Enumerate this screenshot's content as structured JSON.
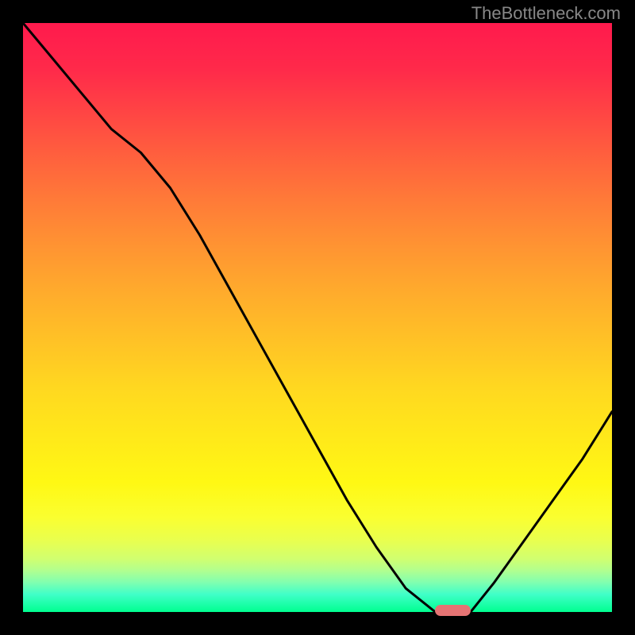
{
  "watermark": "TheBottleneck.com",
  "chart_data": {
    "type": "line",
    "title": "",
    "xlabel": "",
    "ylabel": "",
    "x": [
      0,
      5,
      10,
      15,
      20,
      25,
      30,
      35,
      40,
      45,
      50,
      55,
      60,
      65,
      70,
      73,
      76,
      80,
      85,
      90,
      95,
      100
    ],
    "values": [
      100,
      94,
      88,
      82,
      78,
      72,
      64,
      55,
      46,
      37,
      28,
      19,
      11,
      4,
      0,
      0,
      0,
      5,
      12,
      19,
      26,
      34
    ],
    "ylim": [
      0,
      100
    ],
    "xlim": [
      0,
      100
    ],
    "marker": {
      "x_start": 70,
      "x_end": 76,
      "y": 0
    },
    "background": "rainbow-gradient-red-to-green",
    "note": "V-shaped bottleneck curve. Values are approximate percentages read from image; minimum (optimal point) occurs around x=70-76%. Axes have no visible tick labels."
  },
  "colors": {
    "background": "#000000",
    "watermark": "#888888",
    "curve": "#000000",
    "marker": "#e57373",
    "gradient_top": "#ff1a4d",
    "gradient_bottom": "#00ff90"
  }
}
